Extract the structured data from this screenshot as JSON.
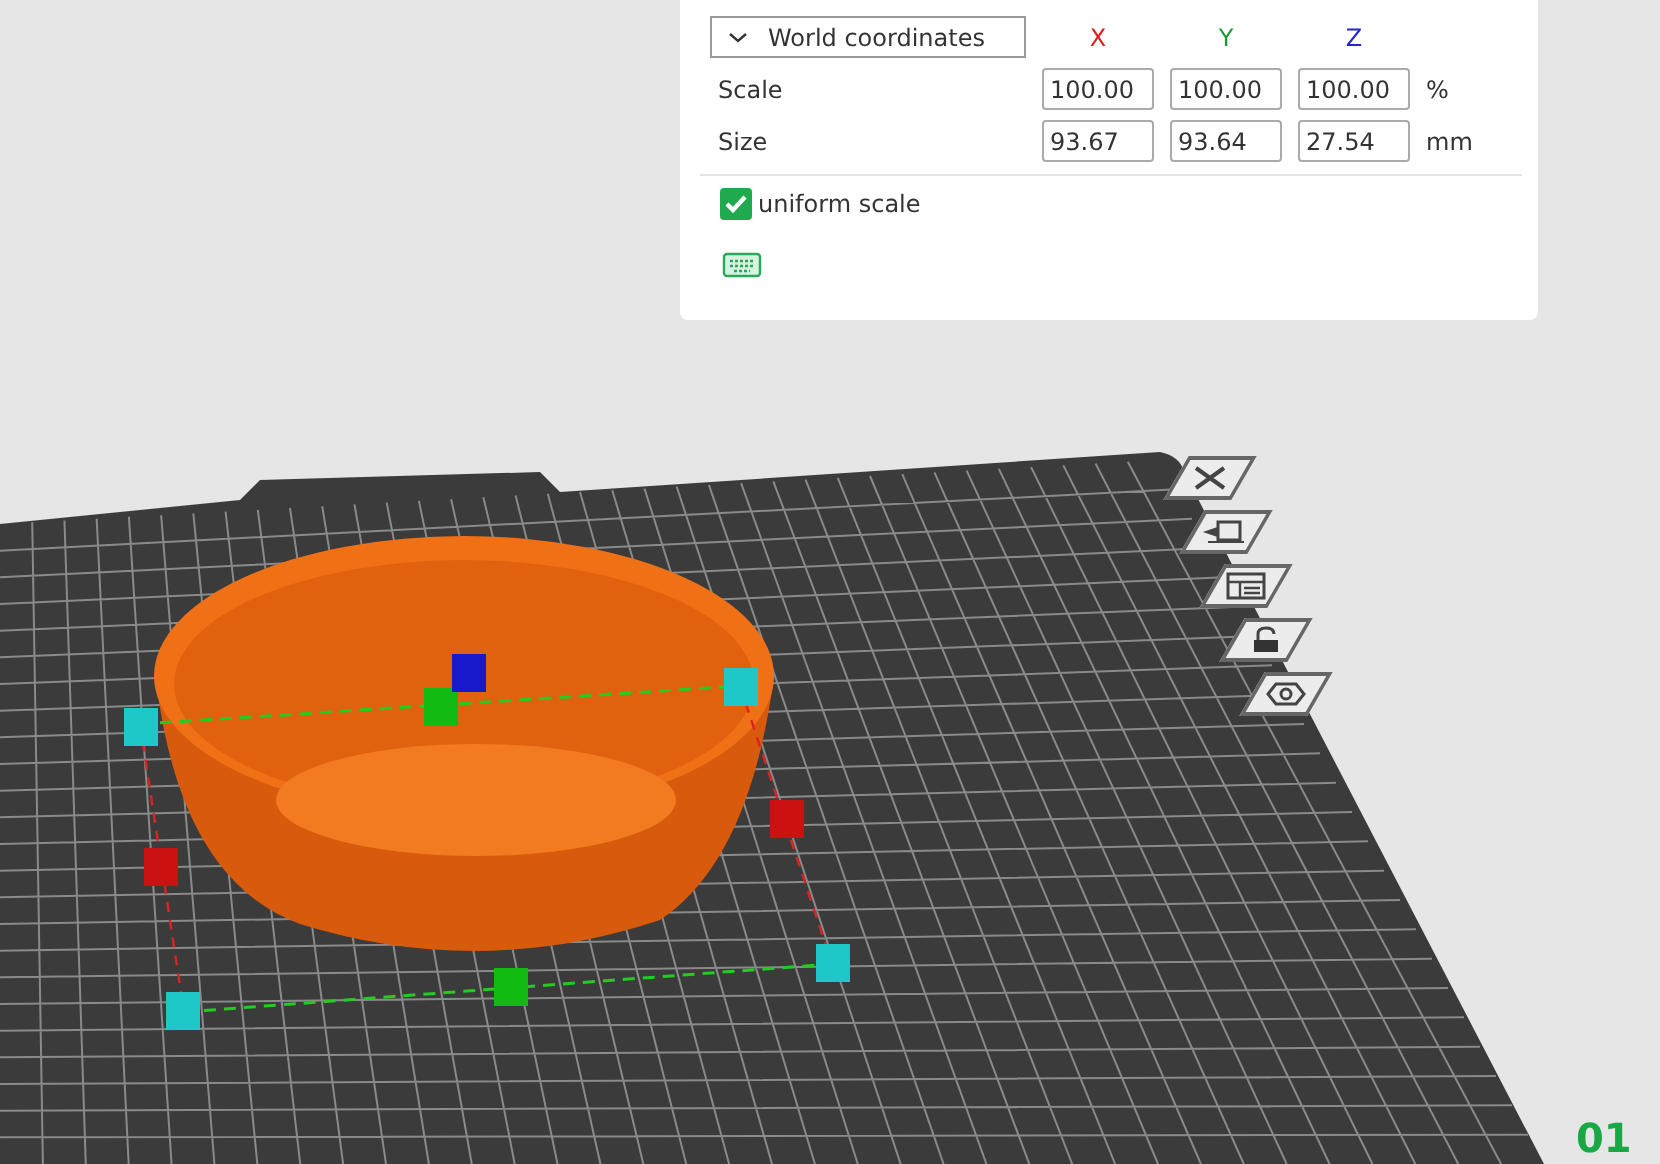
{
  "transform_panel": {
    "coordinate_dropdown": {
      "value": "World coordinates"
    },
    "axis_headers": [
      {
        "label": "X",
        "color": "#e01b1b"
      },
      {
        "label": "Y",
        "color": "#1c9a3a"
      },
      {
        "label": "Z",
        "color": "#2424d0"
      }
    ],
    "rows": [
      {
        "label": "Scale",
        "values": [
          "100.00",
          "100.00",
          "100.00"
        ],
        "unit": "%"
      },
      {
        "label": "Size",
        "values": [
          "93.67",
          "93.64",
          "27.54"
        ],
        "unit": "mm"
      }
    ],
    "uniform_scale": {
      "label": "uniform scale",
      "checked": true
    }
  },
  "plate_tools": [
    {
      "kind": "close"
    },
    {
      "kind": "camera"
    },
    {
      "kind": "layout"
    },
    {
      "kind": "lock"
    },
    {
      "kind": "settings"
    }
  ],
  "plate_number": "01"
}
